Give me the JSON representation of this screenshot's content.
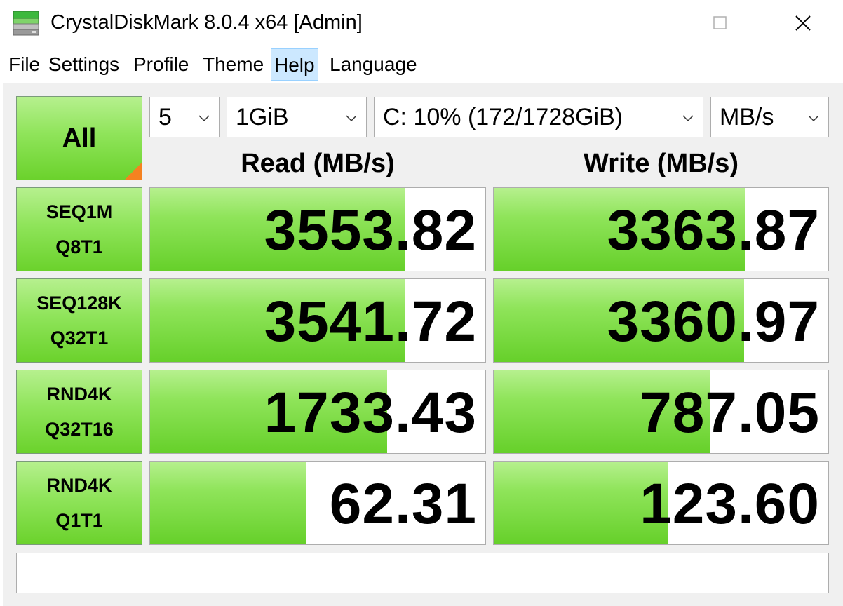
{
  "window": {
    "title": "CrystalDiskMark 8.0.4 x64 [Admin]"
  },
  "menu": {
    "items": [
      {
        "label": "File"
      },
      {
        "label": "Settings"
      },
      {
        "label": "Profile"
      },
      {
        "label": "Theme"
      },
      {
        "label": "Help"
      },
      {
        "label": "Language"
      }
    ],
    "active": "Help"
  },
  "controls": {
    "all_label": "All",
    "count": "5",
    "size": "1GiB",
    "drive": "C: 10% (172/1728GiB)",
    "unit": "MB/s"
  },
  "columns": {
    "read": "Read (MB/s)",
    "write": "Write (MB/s)"
  },
  "rows": [
    {
      "line1": "SEQ1M",
      "line2": "Q8T1",
      "read": "3553.82",
      "write": "3363.87",
      "read_fill": 0.76,
      "write_fill": 0.75
    },
    {
      "line1": "SEQ128K",
      "line2": "Q32T1",
      "read": "3541.72",
      "write": "3360.97",
      "read_fill": 0.759,
      "write_fill": 0.749
    },
    {
      "line1": "RND4K",
      "line2": "Q32T16",
      "read": "1733.43",
      "write": "787.05",
      "read_fill": 0.707,
      "write_fill": 0.646
    },
    {
      "line1": "RND4K",
      "line2": "Q1T1",
      "read": "62.31",
      "write": "123.60",
      "read_fill": 0.466,
      "write_fill": 0.52
    }
  ],
  "comment": "",
  "colors": {
    "accent_green": "#8fe45a",
    "corner_orange": "#f58220",
    "menu_highlight": "#cce8ff"
  }
}
